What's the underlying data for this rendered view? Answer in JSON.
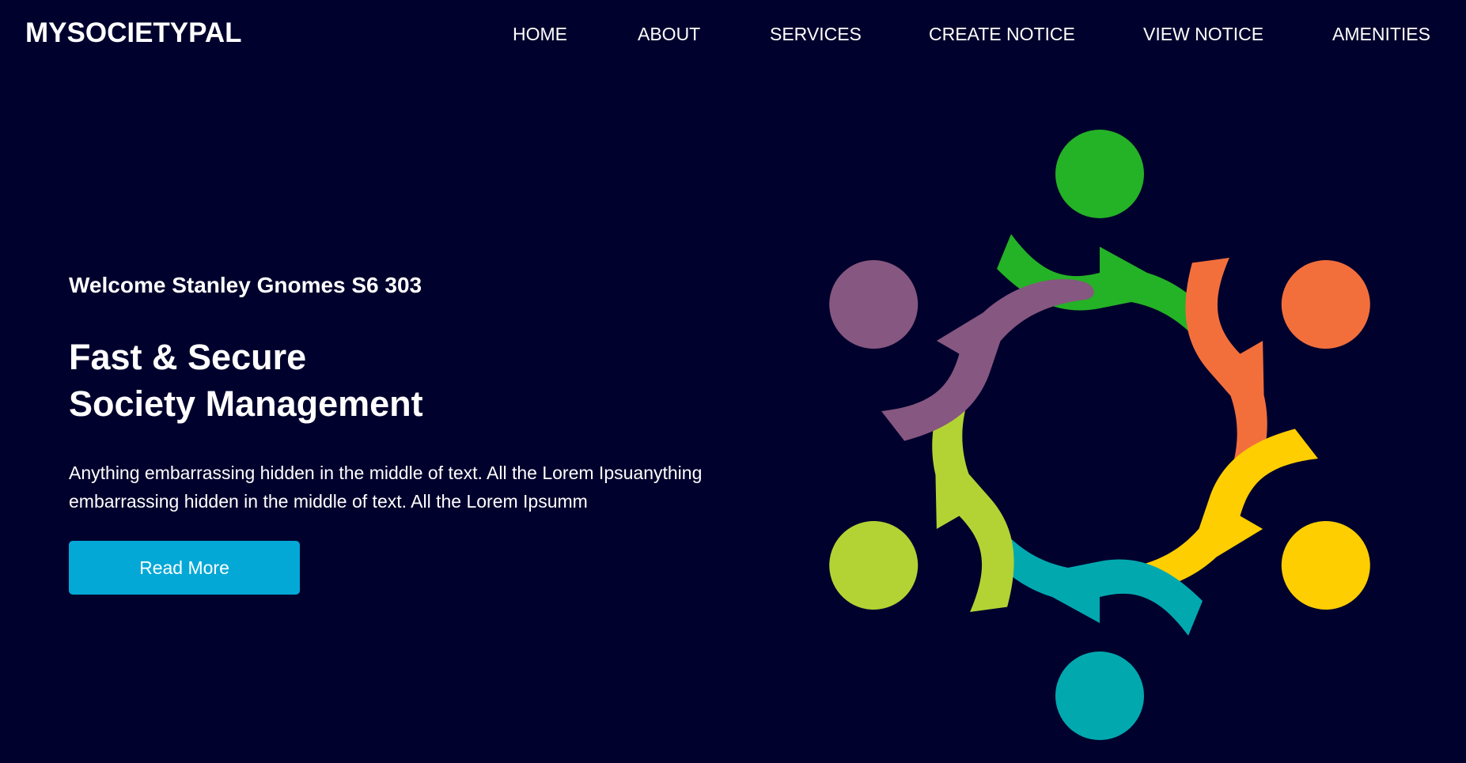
{
  "brand": "MYSOCIETYPAL",
  "nav": {
    "home": "HOME",
    "about": "ABOUT",
    "services": "SERVICES",
    "create_notice": "CREATE NOTICE",
    "view_notice": "VIEW NOTICE",
    "amenities": "AMENITIES"
  },
  "hero": {
    "welcome": "Welcome Stanley Gnomes S6 303",
    "headline_line1": "Fast & Secure",
    "headline_line2": "Society Management",
    "description": "Anything embarrassing hidden in the middle of text. All the Lorem Ipsuanything embarrassing hidden in the middle of text. All the Lorem Ipsumm",
    "button_label": "Read More"
  },
  "colors": {
    "background": "#01012d",
    "button": "#03a8d6",
    "people": [
      "#24b226",
      "#f26f3c",
      "#fece01",
      "#01a9af",
      "#b3d334",
      "#865780"
    ]
  }
}
